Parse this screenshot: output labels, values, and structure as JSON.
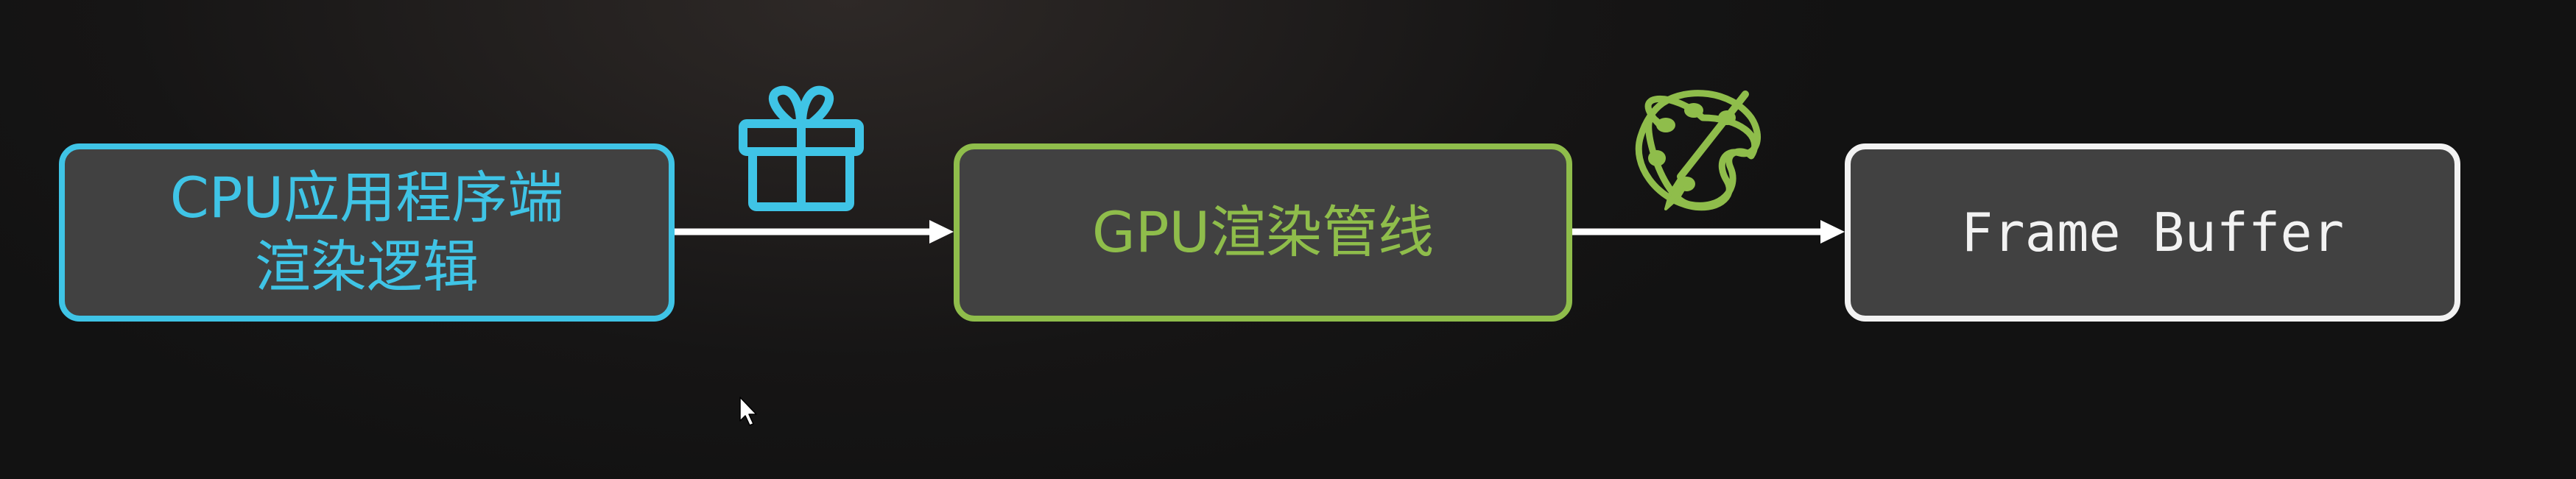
{
  "diagram": {
    "nodes": [
      {
        "id": "cpu",
        "lines": [
          "CPU应用程序端",
          "渲染逻辑"
        ],
        "color": "#3fc4e6"
      },
      {
        "id": "gpu",
        "lines": [
          "GPU渲染管线"
        ],
        "color": "#8fbd4b"
      },
      {
        "id": "frame_buffer",
        "lines": [
          "Frame Buffer"
        ],
        "color": "#f2f2f2"
      }
    ],
    "edges": [
      {
        "from": "cpu",
        "to": "gpu",
        "icon": "gift-icon",
        "icon_color": "#3fc4e6"
      },
      {
        "from": "gpu",
        "to": "frame_buffer",
        "icon": "paint-palette-icon",
        "icon_color": "#8fbd4b"
      }
    ],
    "arrow_color": "#ffffff",
    "background_color": "#1a1818"
  }
}
